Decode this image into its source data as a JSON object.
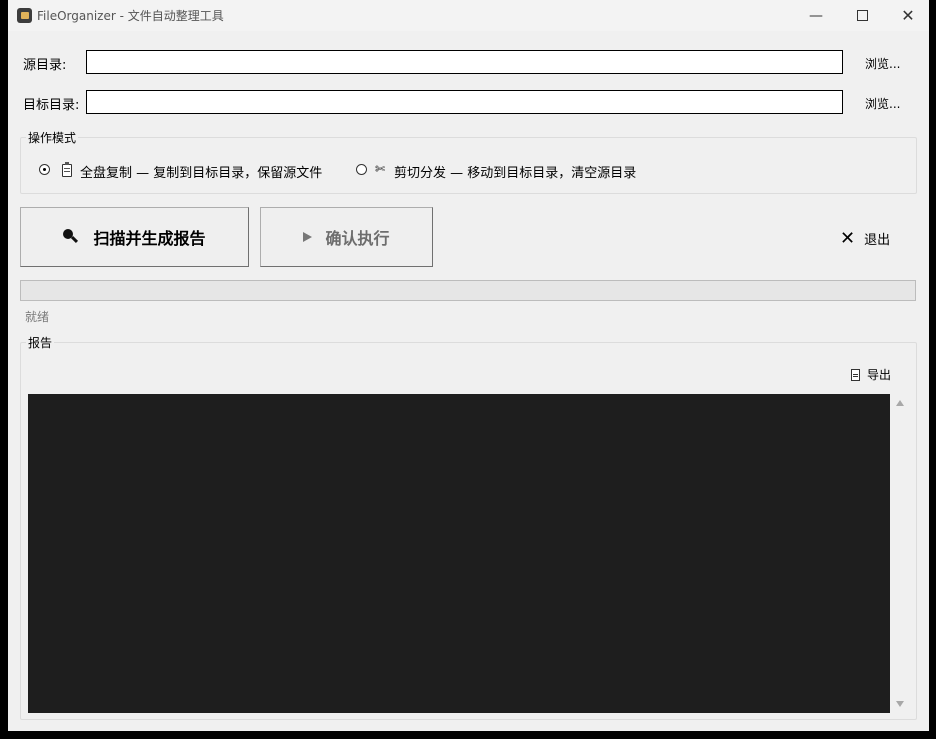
{
  "window": {
    "title": "FileOrganizer - 文件自动整理工具"
  },
  "source": {
    "label": "源目录:",
    "value": "",
    "browse_label": "浏览..."
  },
  "target": {
    "label": "目标目录:",
    "value": "",
    "browse_label": "浏览..."
  },
  "mode": {
    "group_title": "操作模式",
    "options": [
      {
        "icon": "clipboard-icon",
        "label": "全盘复制 — 复制到目标目录，保留源文件",
        "selected": true
      },
      {
        "icon": "scissors-icon",
        "label": "剪切分发 — 移动到目标目录，清空源目录",
        "selected": false
      }
    ]
  },
  "actions": {
    "scan_label": "扫描并生成报告",
    "scan_icon": "magnifier-icon",
    "confirm_label": "确认执行",
    "confirm_icon": "play-icon",
    "confirm_enabled": false,
    "exit_label": "退出",
    "exit_icon": "x-icon"
  },
  "progress": {
    "value": 0,
    "status_text": "就绪"
  },
  "report": {
    "group_title": "报告",
    "export_label": "导出",
    "export_icon": "document-icon",
    "content": ""
  },
  "colors": {
    "report_background": "#1e1e1e",
    "window_background": "#f0f0f0"
  }
}
